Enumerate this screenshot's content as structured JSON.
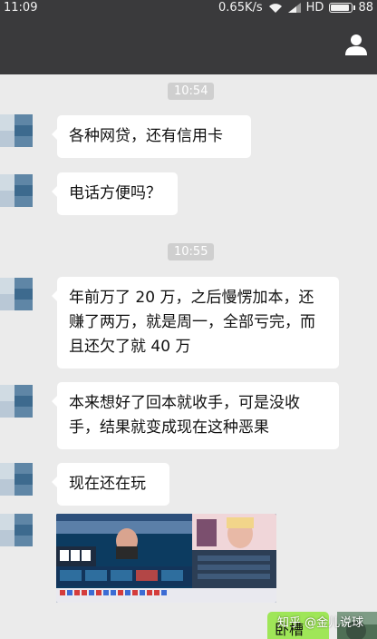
{
  "status_bar": {
    "time": "11:09",
    "network_speed": "0.65K/s",
    "network_type": "HD",
    "battery": "88"
  },
  "header": {
    "icon": "person-icon"
  },
  "chat": {
    "time_1": "10:54",
    "time_2": "10:55",
    "messages": [
      {
        "lines": [
          "各种网贷，还有信用卡"
        ]
      },
      {
        "lines": [
          "电话方便吗？"
        ]
      },
      {
        "lines": [
          "年前万了 20 万，之后慢愣加本，还",
          "赚了两万，就是周一，全部亏完，而",
          "且还欠了就 40 万"
        ]
      },
      {
        "lines": [
          "本来想好了回本就收手，可是没收",
          "手，结果就变成现在这种恶果"
        ]
      },
      {
        "lines": [
          "现在还在玩"
        ]
      }
    ],
    "my_message": "卧槽"
  },
  "watermark": "知乎 @金儿说球",
  "colors": {
    "header_bg": "#3a3a3c",
    "chat_bg": "#ebebeb",
    "incoming_bubble": "#ffffff",
    "outgoing_bubble": "#9fe658"
  }
}
